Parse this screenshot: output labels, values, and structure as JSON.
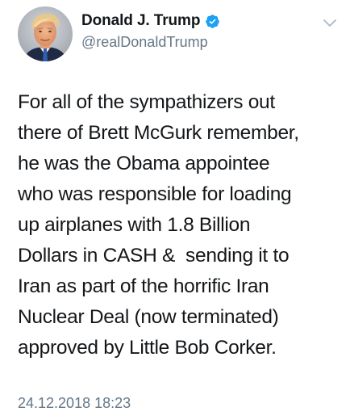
{
  "author": {
    "display_name": "Donald J. Trump",
    "handle": "@realDonaldTrump",
    "verified": true,
    "avatar_icon": "profile-photo",
    "verified_icon": "verified-badge-icon",
    "menu_icon": "chevron-down-icon"
  },
  "tweet": {
    "lines": [
      "For all of the sympathizers out",
      "there of Brett McGurk remember,",
      "he was the Obama appointee",
      "who was responsible for loading",
      "up airplanes with 1.8 Billion",
      "Dollars in CASH &  sending it to",
      "Iran as part of the horrific Iran",
      "Nuclear Deal (now terminated)",
      "approved by Little Bob Corker."
    ],
    "timestamp": "24.12.2018 18:23"
  },
  "colors": {
    "text": "#14171a",
    "secondary": "#657786",
    "verified_badge": "#1da1f2",
    "background": "#ffffff"
  }
}
